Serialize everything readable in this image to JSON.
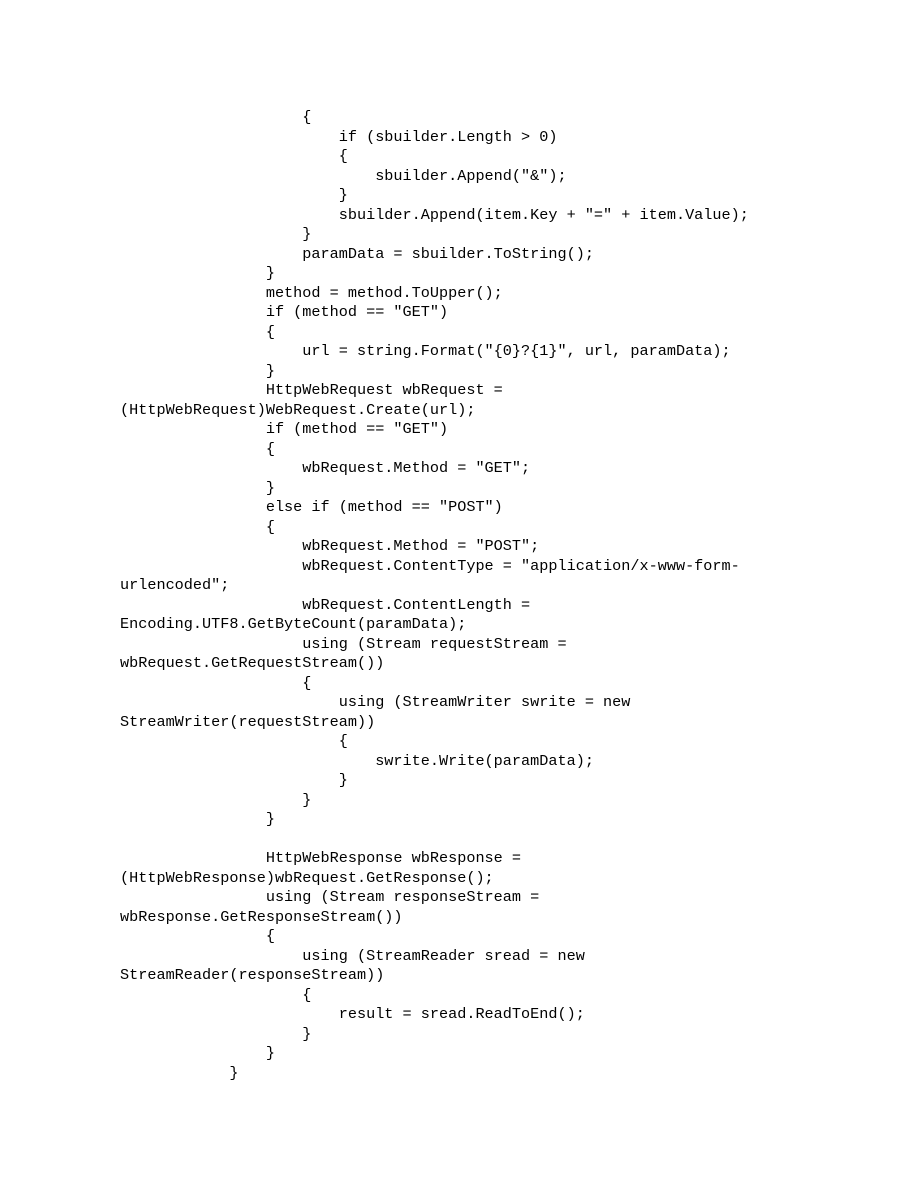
{
  "code": {
    "lines": [
      "                    {",
      "                        if (sbuilder.Length > 0)",
      "                        {",
      "                            sbuilder.Append(\"&\");",
      "                        }",
      "                        sbuilder.Append(item.Key + \"=\" + item.Value);",
      "                    }",
      "                    paramData = sbuilder.ToString();",
      "                }",
      "                method = method.ToUpper();",
      "                if (method == \"GET\")",
      "                {",
      "                    url = string.Format(\"{0}?{1}\", url, paramData);",
      "                }",
      "                HttpWebRequest wbRequest = ",
      "(HttpWebRequest)WebRequest.Create(url);",
      "                if (method == \"GET\")",
      "                {",
      "                    wbRequest.Method = \"GET\";",
      "                }",
      "                else if (method == \"POST\")",
      "                {",
      "                    wbRequest.Method = \"POST\";",
      "                    wbRequest.ContentType = \"application/x-www-form-",
      "urlencoded\";",
      "                    wbRequest.ContentLength = ",
      "Encoding.UTF8.GetByteCount(paramData);",
      "                    using (Stream requestStream = ",
      "wbRequest.GetRequestStream())",
      "                    {",
      "                        using (StreamWriter swrite = new ",
      "StreamWriter(requestStream))",
      "                        {",
      "                            swrite.Write(paramData);",
      "                        }",
      "                    }",
      "                }",
      "",
      "                HttpWebResponse wbResponse = ",
      "(HttpWebResponse)wbRequest.GetResponse();",
      "                using (Stream responseStream = ",
      "wbResponse.GetResponseStream())",
      "                {",
      "                    using (StreamReader sread = new ",
      "StreamReader(responseStream))",
      "                    {",
      "                        result = sread.ReadToEnd();",
      "                    }",
      "                }",
      "            }"
    ]
  }
}
